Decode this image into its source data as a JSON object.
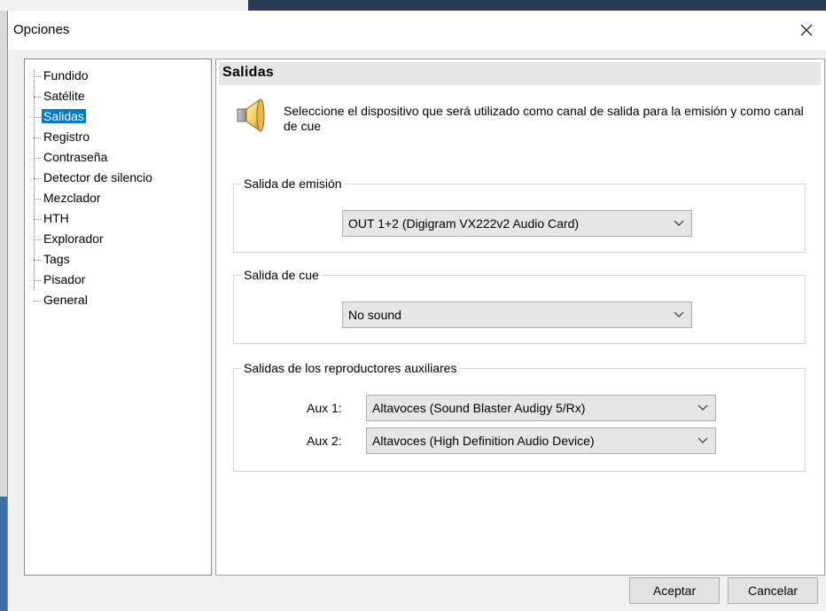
{
  "window": {
    "title": "Opciones"
  },
  "tree": {
    "items": [
      {
        "label": "Fundido"
      },
      {
        "label": "Satélite"
      },
      {
        "label": "Salidas",
        "selected": true
      },
      {
        "label": "Registro"
      },
      {
        "label": "Contraseña"
      },
      {
        "label": "Detector de silencio"
      },
      {
        "label": "Mezclador"
      },
      {
        "label": "HTH"
      },
      {
        "label": "Explorador"
      },
      {
        "label": "Tags"
      },
      {
        "label": "Pisador"
      },
      {
        "label": "General"
      }
    ]
  },
  "content": {
    "title": "Salidas",
    "description": "Seleccione el dispositivo que será utilizado como canal de salida para la emisión y como canal de cue",
    "emission": {
      "legend": "Salida de emisión",
      "selected": "OUT  1+2 (Digigram VX222v2 Audio Card)"
    },
    "cue": {
      "legend": "Salida de cue",
      "selected": "No sound"
    },
    "aux": {
      "legend": "Salidas de los reproductores auxiliares",
      "aux1_label": "Aux 1:",
      "aux1_selected": "Altavoces (Sound Blaster Audigy 5/Rx)",
      "aux2_label": "Aux 2:",
      "aux2_selected": "Altavoces (High Definition Audio Device)"
    }
  },
  "buttons": {
    "accept": "Aceptar",
    "cancel": "Cancelar"
  },
  "icons": {
    "close": "close-icon",
    "speaker": "speaker-icon",
    "dropdown": "chevron-down-icon"
  },
  "colors": {
    "selection": "#0078d7",
    "dialog_bg": "#f0f0f0",
    "header_bg": "#e5e5e5"
  }
}
